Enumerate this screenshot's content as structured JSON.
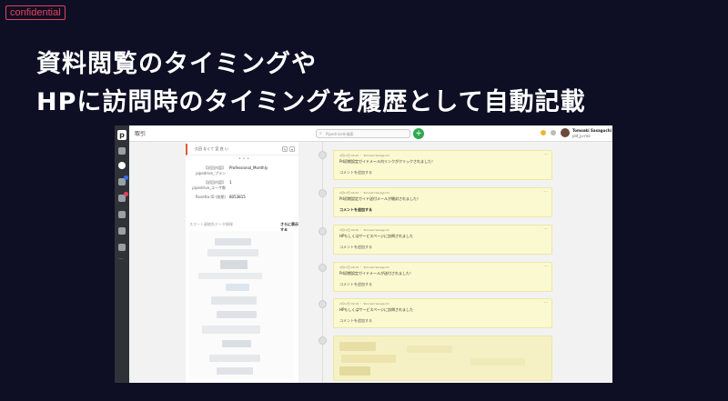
{
  "badge_label": "confidential",
  "headline_line1": "資料閲覧のタイミングや",
  "headline_line2": "HPに訪問時のタイミングを履歴として自動記載",
  "app": {
    "page_title": "取引",
    "search_placeholder": "Pipedriveを検索",
    "add_symbol": "+",
    "user_name": "Tomoaki Sasaguchi",
    "user_company": "pld_ju-mo",
    "logo_letter": "p"
  },
  "deal_panel": {
    "header_text": "久田 なくて 宮 良 い",
    "dots": "• • •",
    "fields": [
      {
        "label": "【初回内容】 pipedrive_プラン",
        "value": "Professional_Monthly"
      },
      {
        "label": "【初回内容】 pipedrive_ユーザ数",
        "value": "1"
      },
      {
        "label": "Rosetta ID (前期)",
        "value": "8053815"
      }
    ],
    "section_label": "スマート連絡先データ情報",
    "section_action": "さらに表示する"
  },
  "timeline": {
    "comment_label": "コメントを追加する",
    "items": [
      {
        "meta": "2月12日 09:22 ・ Tomoaki Sasaguchi",
        "message": "Pd初期設定ガイドメール内リンクがクリックされました！",
        "comment_bold": false
      },
      {
        "meta": "2月12日 09:22 ・ Tomoaki Sasaguchi",
        "message": "Pd初期設定ガイド送付メールが開封されました！",
        "comment_bold": true
      },
      {
        "meta": "2月12日 09:20 ・ Tomoaki Sasaguchi",
        "message": "HPもしくはサービスページに訪問されました",
        "comment_bold": false
      },
      {
        "meta": "2月12日 09:19 ・ Tomoaki Sasaguchi",
        "message": "Pd初期設定ガイドメールが送付されました！",
        "comment_bold": false
      },
      {
        "meta": "2月12日 09:19 ・ Tomoaki Sasaguchi",
        "message": "HPもしくはサービスページに訪問されました",
        "comment_bold": false
      }
    ]
  },
  "colors": {
    "background": "#0e0e24",
    "badge": "#e2435b",
    "note_card": "#fbf9cf",
    "add_button": "#2fa84f",
    "accent_bar": "#e8563c"
  }
}
